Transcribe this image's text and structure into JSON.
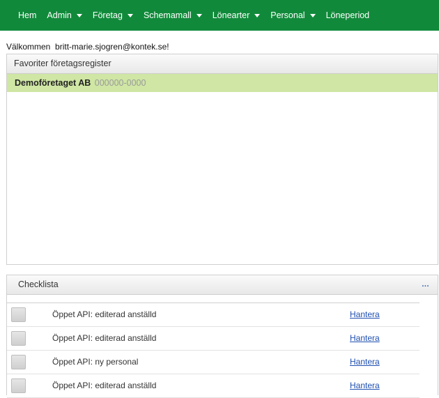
{
  "nav": {
    "items": [
      {
        "label": "Hem",
        "dropdown": false
      },
      {
        "label": "Admin",
        "dropdown": true
      },
      {
        "label": "Företag",
        "dropdown": true
      },
      {
        "label": "Schemamall",
        "dropdown": true
      },
      {
        "label": "Lönearter",
        "dropdown": true
      },
      {
        "label": "Personal",
        "dropdown": true
      },
      {
        "label": "Löneperiod",
        "dropdown": false
      }
    ],
    "color": "#108a3a"
  },
  "welcome": {
    "text": "Välkommen  britt-marie.sjogren@kontek.se!"
  },
  "favorites": {
    "title": "Favoriter företagsregister",
    "company": {
      "name": "Demoföretaget AB",
      "org_number": "000000-0000"
    },
    "row_color": "#cfe6a4"
  },
  "checklist": {
    "title": "Checklista",
    "more_label": "...",
    "items": [
      {
        "label": "Öppet API: editerad anställd",
        "action": "Hantera"
      },
      {
        "label": "Öppet API: editerad anställd",
        "action": "Hantera"
      },
      {
        "label": "Öppet API: ny personal",
        "action": "Hantera"
      },
      {
        "label": "Öppet API: editerad anställd",
        "action": "Hantera"
      }
    ]
  }
}
